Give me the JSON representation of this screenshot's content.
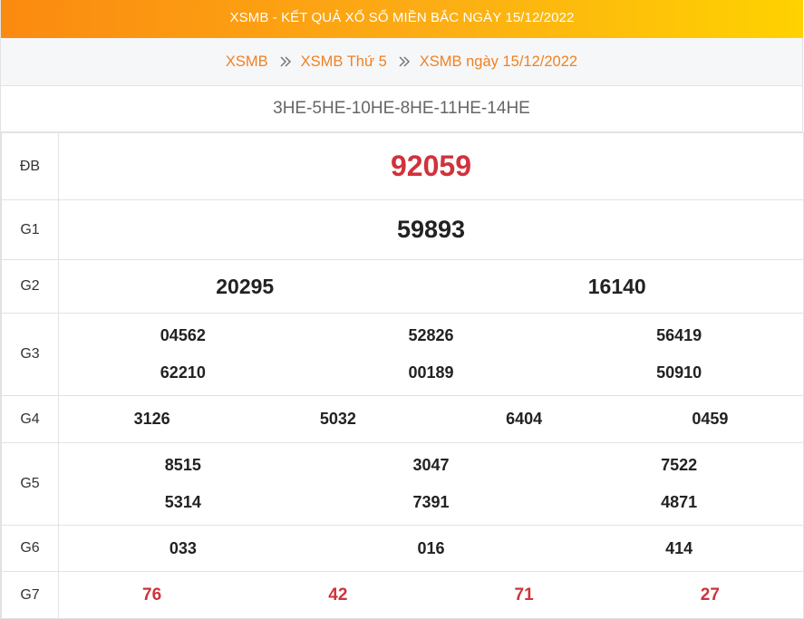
{
  "header": {
    "title": "XSMB - KẾT QUẢ XỔ SỐ MIỀN BẮC NGÀY 15/12/2022"
  },
  "breadcrumb": {
    "items": [
      "XSMB",
      "XSMB Thứ 5",
      "XSMB ngày 15/12/2022"
    ],
    "separator_icon": "double-chevron-right-icon"
  },
  "codes": "3HE-5HE-10HE-8HE-11HE-14HE",
  "colors": {
    "accent": "#f08221",
    "special": "#d0323c",
    "banner_start": "#fb8a10",
    "banner_end": "#ffd200"
  },
  "prizes": {
    "db": {
      "label": "ĐB",
      "numbers": [
        "92059"
      ]
    },
    "g1": {
      "label": "G1",
      "numbers": [
        "59893"
      ]
    },
    "g2": {
      "label": "G2",
      "numbers": [
        "20295",
        "16140"
      ]
    },
    "g3": {
      "label": "G3",
      "numbers": [
        "04562",
        "52826",
        "56419",
        "62210",
        "00189",
        "50910"
      ]
    },
    "g4": {
      "label": "G4",
      "numbers": [
        "3126",
        "5032",
        "6404",
        "0459"
      ]
    },
    "g5": {
      "label": "G5",
      "numbers": [
        "8515",
        "3047",
        "7522",
        "5314",
        "7391",
        "4871"
      ]
    },
    "g6": {
      "label": "G6",
      "numbers": [
        "033",
        "016",
        "414"
      ]
    },
    "g7": {
      "label": "G7",
      "numbers": [
        "76",
        "42",
        "71",
        "27"
      ]
    }
  }
}
